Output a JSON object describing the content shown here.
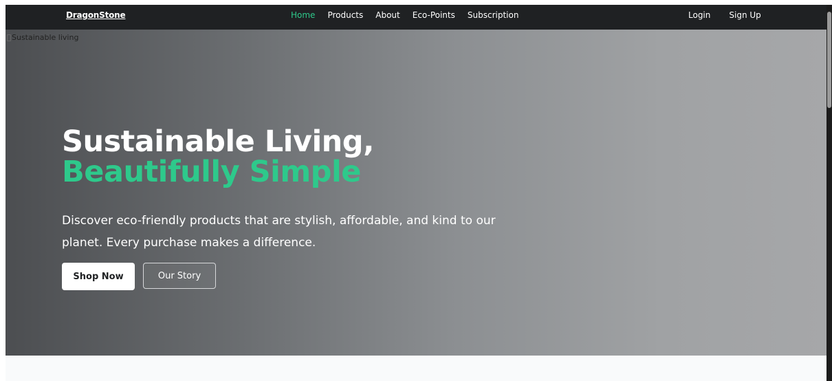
{
  "navbar": {
    "brand": "DragonStone",
    "links": [
      "Home",
      "Products",
      "About",
      "Eco-Points",
      "Subscription"
    ],
    "active": "Home",
    "auth": {
      "login": "Login",
      "signup": "Sign Up"
    }
  },
  "hero": {
    "image_alt": "Sustainable living",
    "title_line1": "Sustainable Living,",
    "title_line2": "Beautifully Simple",
    "subtitle": "Discover eco-friendly products that are stylish, affordable, and kind to our planet. Every purchase makes a difference.",
    "primary_button": "Shop Now",
    "secondary_button": "Our Story"
  },
  "colors": {
    "accent": "#2ec98b",
    "navbar_bg": "#1f2123",
    "page_bg": "#f9fafb"
  }
}
